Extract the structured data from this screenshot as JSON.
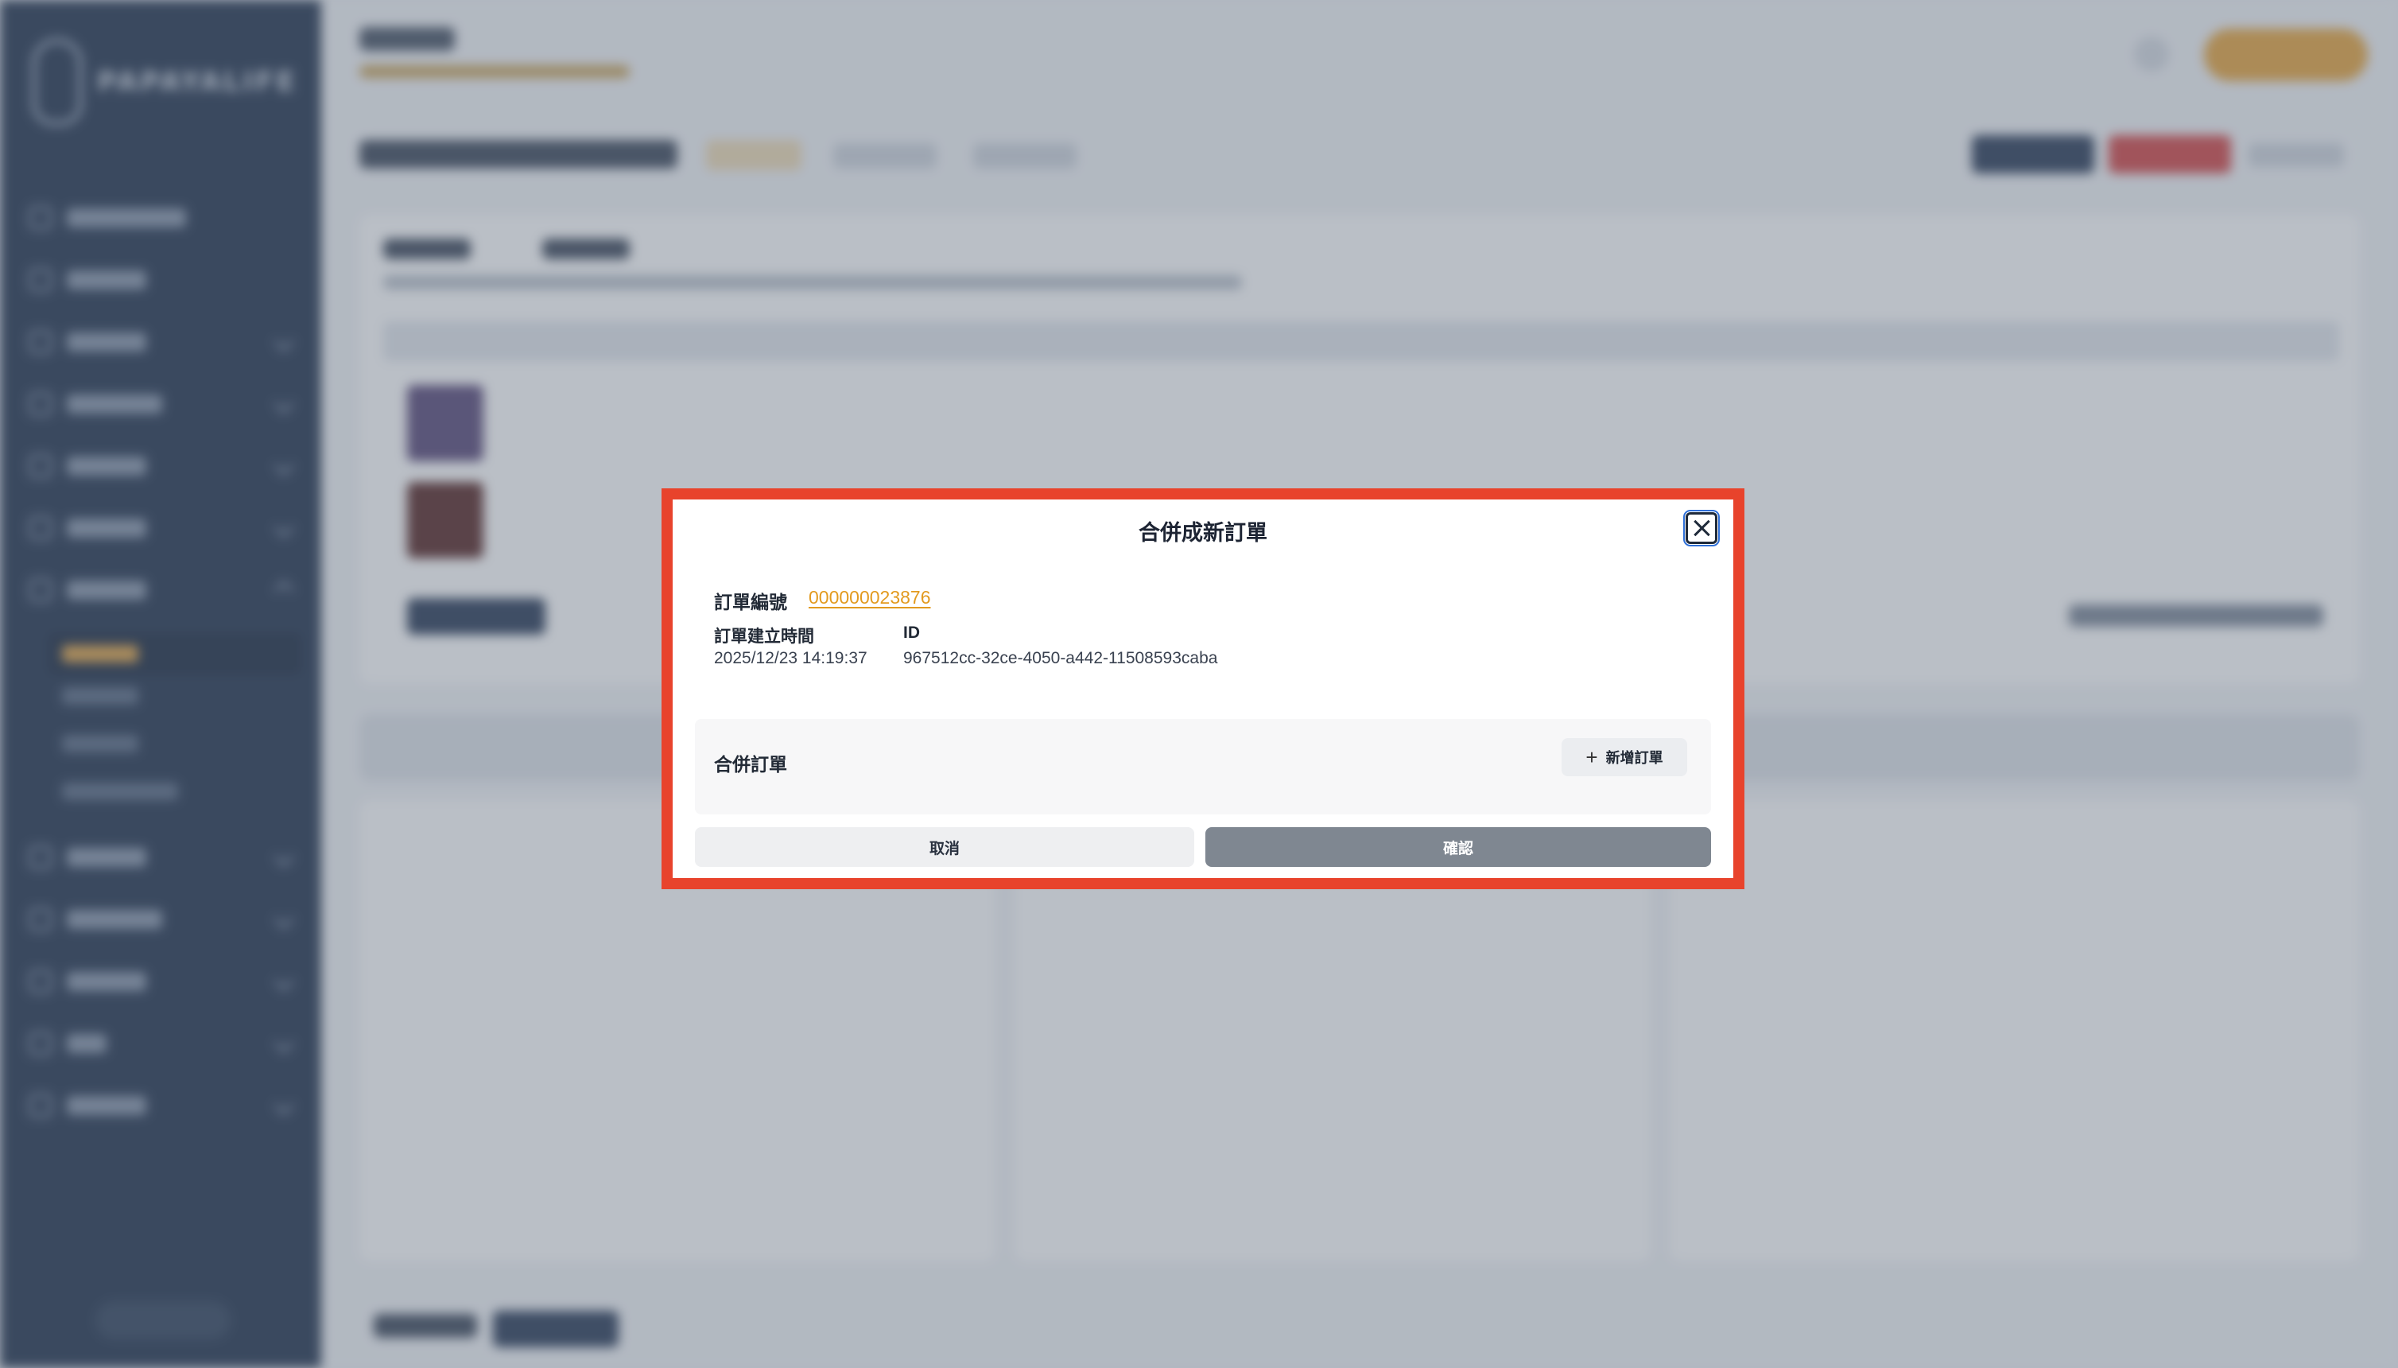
{
  "modal": {
    "title": "合併成新訂單",
    "order_no_label": "訂單編號",
    "order_no": "000000023876",
    "created_label": "訂單建立時間",
    "created_value": "2025/12/23 14:19:37",
    "id_label": "ID",
    "id_value": "967512cc-32ce-4050-a442-11508593caba",
    "merge_label": "合併訂單",
    "add_order_label": "新增訂單",
    "cancel_label": "取消",
    "confirm_label": "確認"
  },
  "colors": {
    "sidebar": "#24354f",
    "highlight": "#e8432c",
    "link": "#e29a1f",
    "confirm": "#7f8791"
  },
  "icons": {
    "close": "close-icon",
    "add": "plus-icon"
  }
}
